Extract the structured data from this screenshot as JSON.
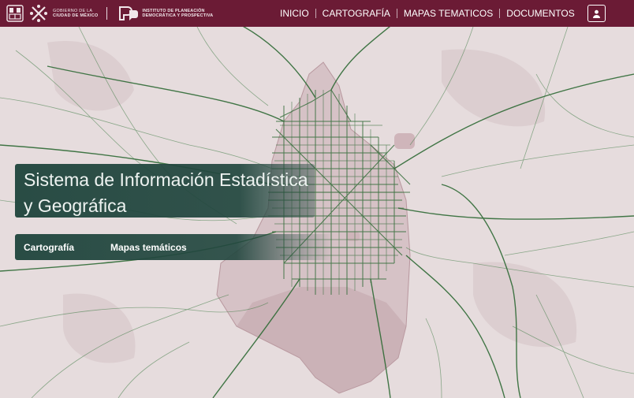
{
  "header": {
    "gov_logo_text": [
      "GOBIERNO DE LA",
      "CIUDAD DE MÉXICO"
    ],
    "ipdp_logo_text": [
      "INSTITUTO DE PLANEACIÓN",
      "DEMOCRÁTICA Y PROSPECTIVA"
    ],
    "nav": [
      {
        "label": "INICIO"
      },
      {
        "label": "CARTOGRAFÍA"
      },
      {
        "label": "MAPAS TEMATICOS"
      },
      {
        "label": "DOCUMENTOS"
      }
    ],
    "user_icon": "user-icon"
  },
  "hero": {
    "title": "Sistema de Información Estadística y Geográfica",
    "links": [
      {
        "label": "Cartografía"
      },
      {
        "label": "Mapas temáticos"
      }
    ]
  },
  "colors": {
    "navbar": "#6b1b35",
    "hero_panel": "#21463e",
    "map_background": "#e6dcdd",
    "road_lines": "#2f6a35",
    "city_boundary": "#c8a9b0"
  }
}
